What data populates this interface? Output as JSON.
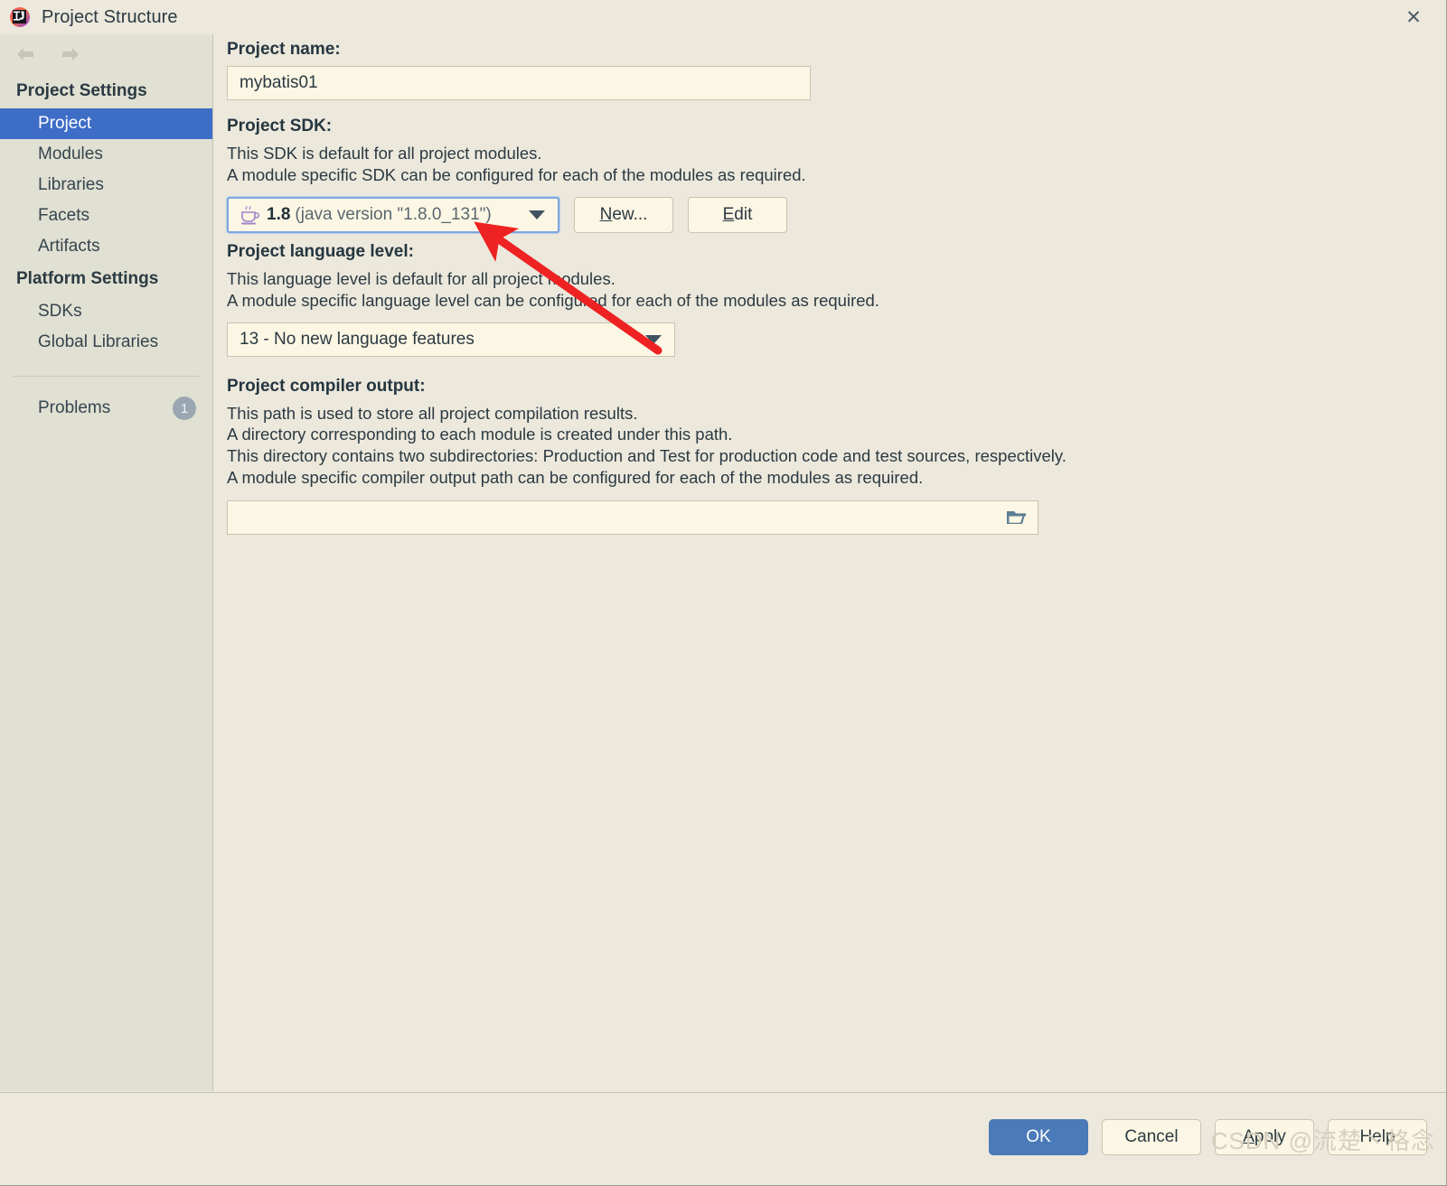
{
  "window": {
    "title": "Project Structure",
    "app_icon": "intellij-idea-logo",
    "close_label": "✕"
  },
  "sidebar": {
    "back_icon": "arrow-left-icon",
    "forward_icon": "arrow-right-icon",
    "groups": [
      {
        "title": "Project Settings",
        "items": [
          {
            "label": "Project",
            "selected": true
          },
          {
            "label": "Modules",
            "selected": false
          },
          {
            "label": "Libraries",
            "selected": false
          },
          {
            "label": "Facets",
            "selected": false
          },
          {
            "label": "Artifacts",
            "selected": false
          }
        ]
      },
      {
        "title": "Platform Settings",
        "items": [
          {
            "label": "SDKs",
            "selected": false
          },
          {
            "label": "Global Libraries",
            "selected": false
          }
        ]
      }
    ],
    "problems": {
      "label": "Problems",
      "count": "1"
    }
  },
  "main": {
    "project_name": {
      "label": "Project name:",
      "value": "mybatis01",
      "placeholder": ""
    },
    "project_sdk": {
      "label": "Project SDK:",
      "desc_line1": "This SDK is default for all project modules.",
      "desc_line2": "A module specific SDK can be configured for each of the modules as required.",
      "selected_version": "1.8",
      "selected_detail": "(java version \"1.8.0_131\")",
      "sdk_icon": "java-coffee-cup-icon",
      "new_button": "New...",
      "new_button_mnemonic": "N",
      "edit_button": "Edit",
      "edit_button_mnemonic": "E"
    },
    "language_level": {
      "label": "Project language level:",
      "desc_line1": "This language level is default for all project modules.",
      "desc_line2": "A module specific language level can be configured for each of the modules as required.",
      "selected": "13 - No new language features"
    },
    "compiler_output": {
      "label": "Project compiler output:",
      "desc_line1": "This path is used to store all project compilation results.",
      "desc_line2": "A directory corresponding to each module is created under this path.",
      "desc_line3": "This directory contains two subdirectories: Production and Test for production code and test sources, respectively.",
      "desc_line4": "A module specific compiler output path can be configured for each of the modules as required.",
      "value": "",
      "browse_icon": "folder-icon"
    }
  },
  "footer": {
    "ok": "OK",
    "cancel": "Cancel",
    "apply": "Apply",
    "apply_mnemonic": "A",
    "help": "Help"
  },
  "annotation": {
    "type": "red-arrow",
    "color": "#EE2222",
    "points_to": "project-sdk-combo"
  },
  "watermark": {
    "text": "CSDN @流楚丶格念"
  },
  "colors": {
    "window_bg": "#ECE8DC",
    "sidebar_bg": "#E0E0D3",
    "field_bg": "#FCF6E4",
    "selection_blue": "#3E6DC6",
    "primary_button": "#4A7AB8",
    "text": "#2b3a42",
    "annotation_red": "#EE2222"
  }
}
